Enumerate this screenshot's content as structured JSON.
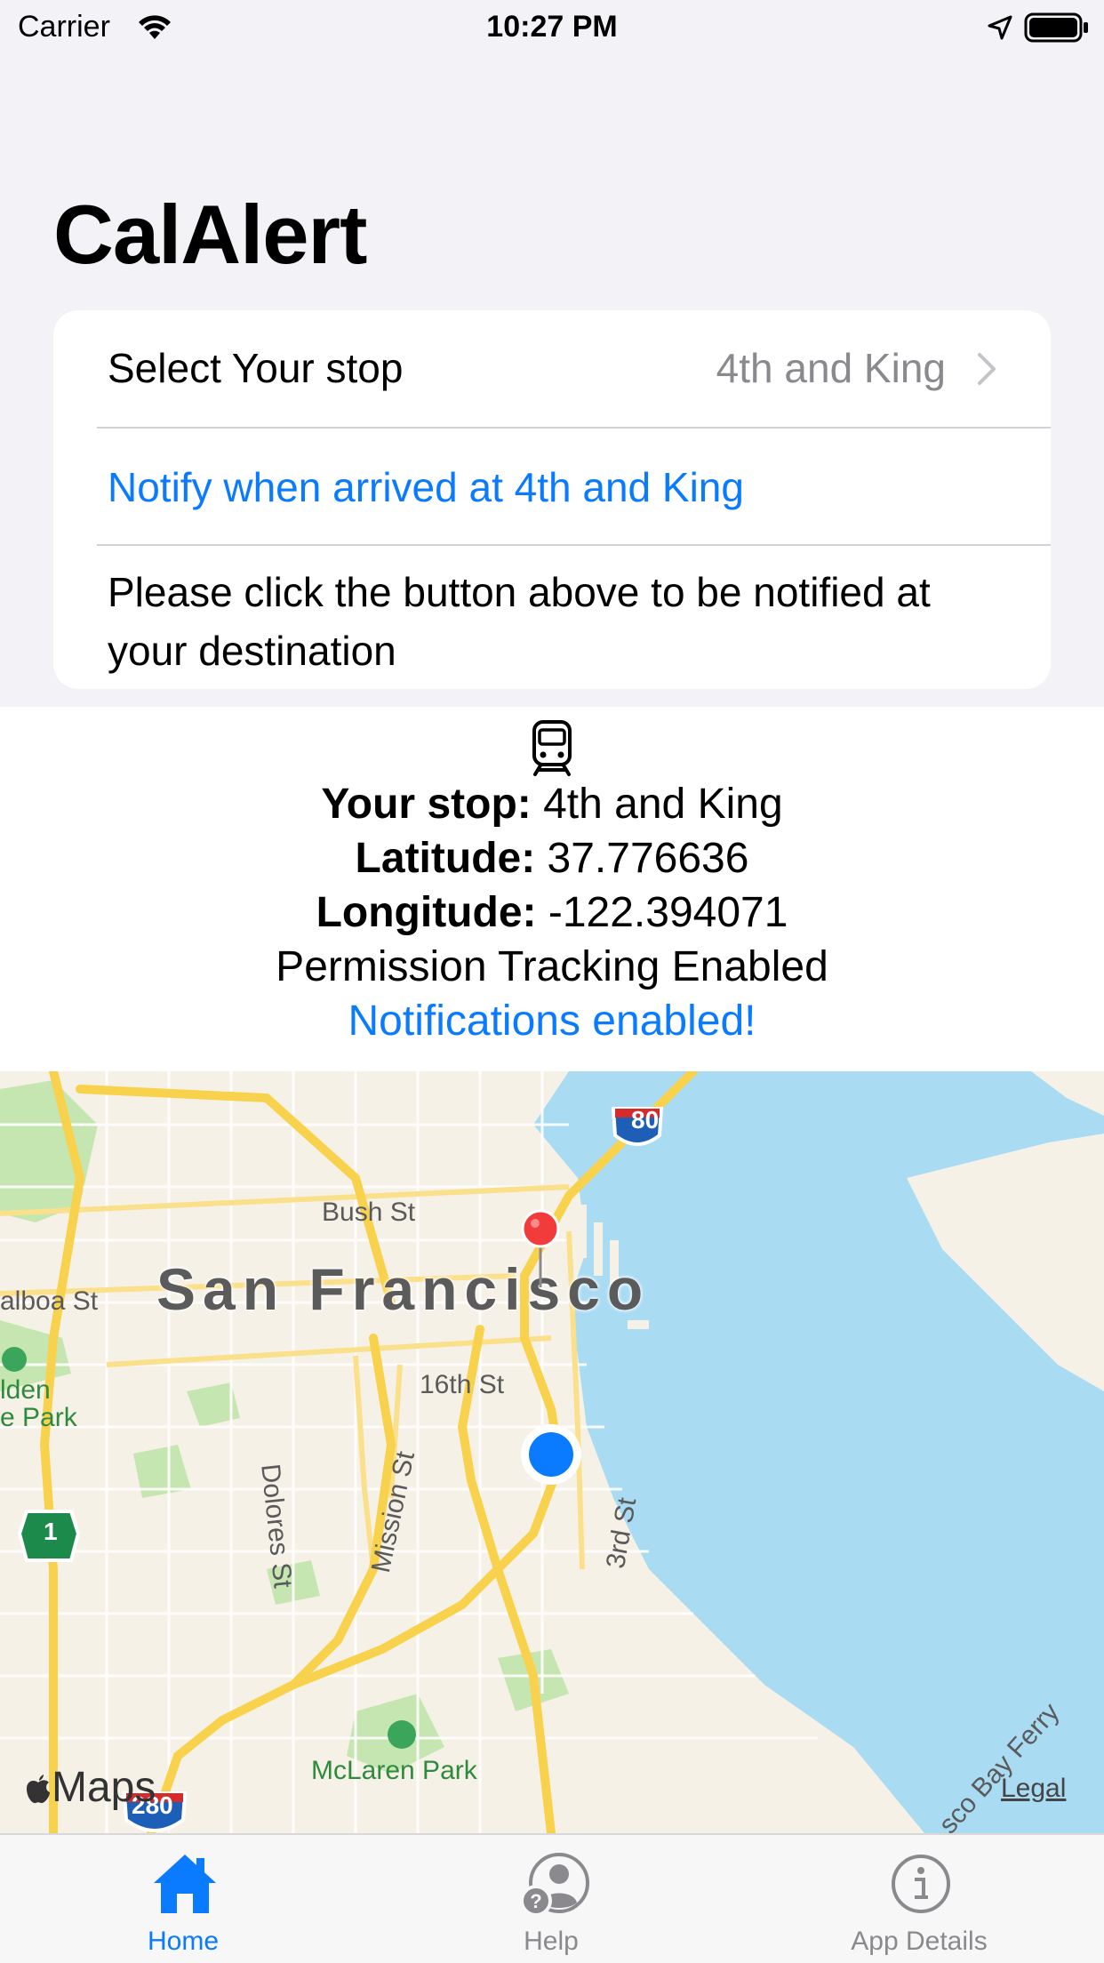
{
  "status_bar": {
    "carrier": "Carrier",
    "time": "10:27 PM",
    "icons": [
      "wifi-icon",
      "location-arrow-icon",
      "battery-icon"
    ]
  },
  "app": {
    "title": "CalAlert"
  },
  "form": {
    "stop_label": "Select Your stop",
    "stop_value": "4th and King",
    "notify_button": "Notify when arrived at 4th and King",
    "instructions": "Please click the button above to be notified at your destination"
  },
  "info": {
    "icon": "train-icon",
    "stop_label": "Your stop:",
    "stop_value": "4th and King",
    "latitude_label": "Latitude:",
    "latitude_value": "37.776636",
    "longitude_label": "Longitude:",
    "longitude_value": "-122.394071",
    "permission": "Permission Tracking Enabled",
    "notification": "Notifications enabled!"
  },
  "map": {
    "city": "San Francisco",
    "labels": {
      "bush": "Bush St",
      "balboa": "alboa St",
      "sixteenth": "16th St",
      "dolores": "Dolores St",
      "mission": "Mission St",
      "third": "3rd St",
      "golden_gate_1": "lden",
      "golden_gate_2": "e Park",
      "mclaren": "McLaren Park",
      "ferry": "sco Bay Ferry"
    },
    "shields": {
      "i80": "80",
      "ca1": "1",
      "i280": "280"
    },
    "brand": "Maps",
    "legal": "Legal",
    "colors": {
      "water": "#a9dbf3",
      "land": "#f6f1e7",
      "park": "#c6e6b1",
      "highway": "#f8d24c",
      "pin": "#f23c3c",
      "user": "#0a7aff"
    }
  },
  "tabs": [
    {
      "label": "Home",
      "icon": "house-icon",
      "active": true
    },
    {
      "label": "Help",
      "icon": "help-person-icon",
      "active": false
    },
    {
      "label": "App Details",
      "icon": "info-circle-icon",
      "active": false
    }
  ]
}
